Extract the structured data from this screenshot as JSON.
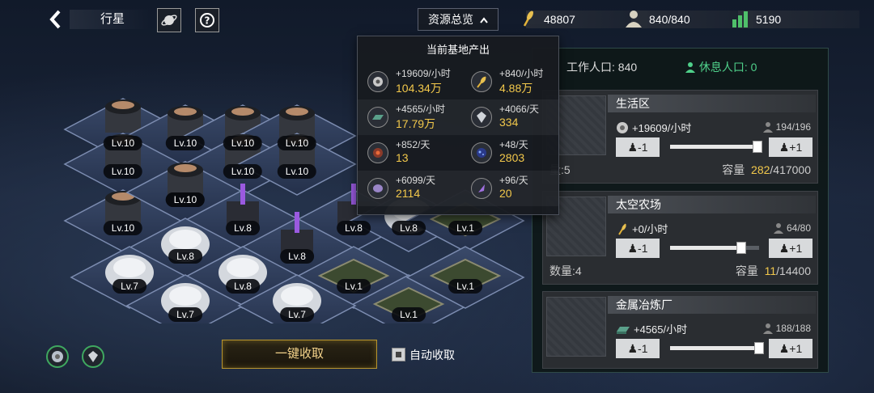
{
  "header": {
    "back_icon": "chevron-left-icon",
    "title": "行星",
    "overview_label": "资源总览"
  },
  "resources": {
    "energy": "48807",
    "population": "840/840",
    "score": "5190"
  },
  "production_popup": {
    "title": "当前基地产出",
    "items": [
      {
        "icon": "metal-ore-icon",
        "rate": "+19609/小时",
        "total": "104.34万"
      },
      {
        "icon": "wheat-icon",
        "rate": "+840/小时",
        "total": "4.88万"
      },
      {
        "icon": "alloy-ingot-icon",
        "rate": "+4565/小时",
        "total": "17.79万"
      },
      {
        "icon": "crystal-icon",
        "rate": "+4066/天",
        "total": "334"
      },
      {
        "icon": "core-orb-icon",
        "rate": "+852/天",
        "total": "13"
      },
      {
        "icon": "nebula-icon",
        "rate": "+48/天",
        "total": "2803"
      },
      {
        "icon": "purple-gem-icon",
        "rate": "+6099/天",
        "total": "2114"
      },
      {
        "icon": "shard-icon",
        "rate": "+96/天",
        "total": "20"
      }
    ]
  },
  "workforce": {
    "working": "工作人口: 840",
    "resting": "休息人口: 0"
  },
  "facilities": [
    {
      "name": "生活区",
      "res_icon": "metal-ore-icon",
      "rate": "+19609/小时",
      "workers": "194/196",
      "count": "量:5",
      "cap_label": "容量",
      "cap_current": "282",
      "cap_max": "/417000",
      "fill": 0.98
    },
    {
      "name": "太空农场",
      "res_icon": "wheat-icon",
      "rate": "+0/小时",
      "workers": "64/80",
      "count": "数量:4",
      "cap_label": "容量",
      "cap_current": "11",
      "cap_max": "/14400",
      "fill": 0.8
    },
    {
      "name": "金属冶炼厂",
      "res_icon": "alloy-ingot-icon",
      "rate": "+4565/小时",
      "workers": "188/188",
      "fill": 1.0
    }
  ],
  "stepper": {
    "minus": "-1",
    "plus": "+1"
  },
  "board_levels": [
    "Lv.10",
    "Lv.10",
    "Lv.10",
    "Lv.10",
    "Lv.10",
    "Lv.10",
    "Lv.10",
    "Lv.10",
    "Lv.10",
    "Lv.10",
    "Lv.8",
    "Lv.8",
    "Lv.8",
    "Lv.8",
    "Lv.8",
    "Lv.1",
    "Lv.7",
    "Lv.8",
    "Lv.1",
    "Lv.1",
    "Lv.7",
    "Lv.7",
    "Lv.1"
  ],
  "bottom": {
    "collect_label": "一键收取",
    "auto_collect_label": "自动收取"
  },
  "colors": {
    "accent_gold": "#f2c84b",
    "rest_green": "#4fd08a"
  }
}
